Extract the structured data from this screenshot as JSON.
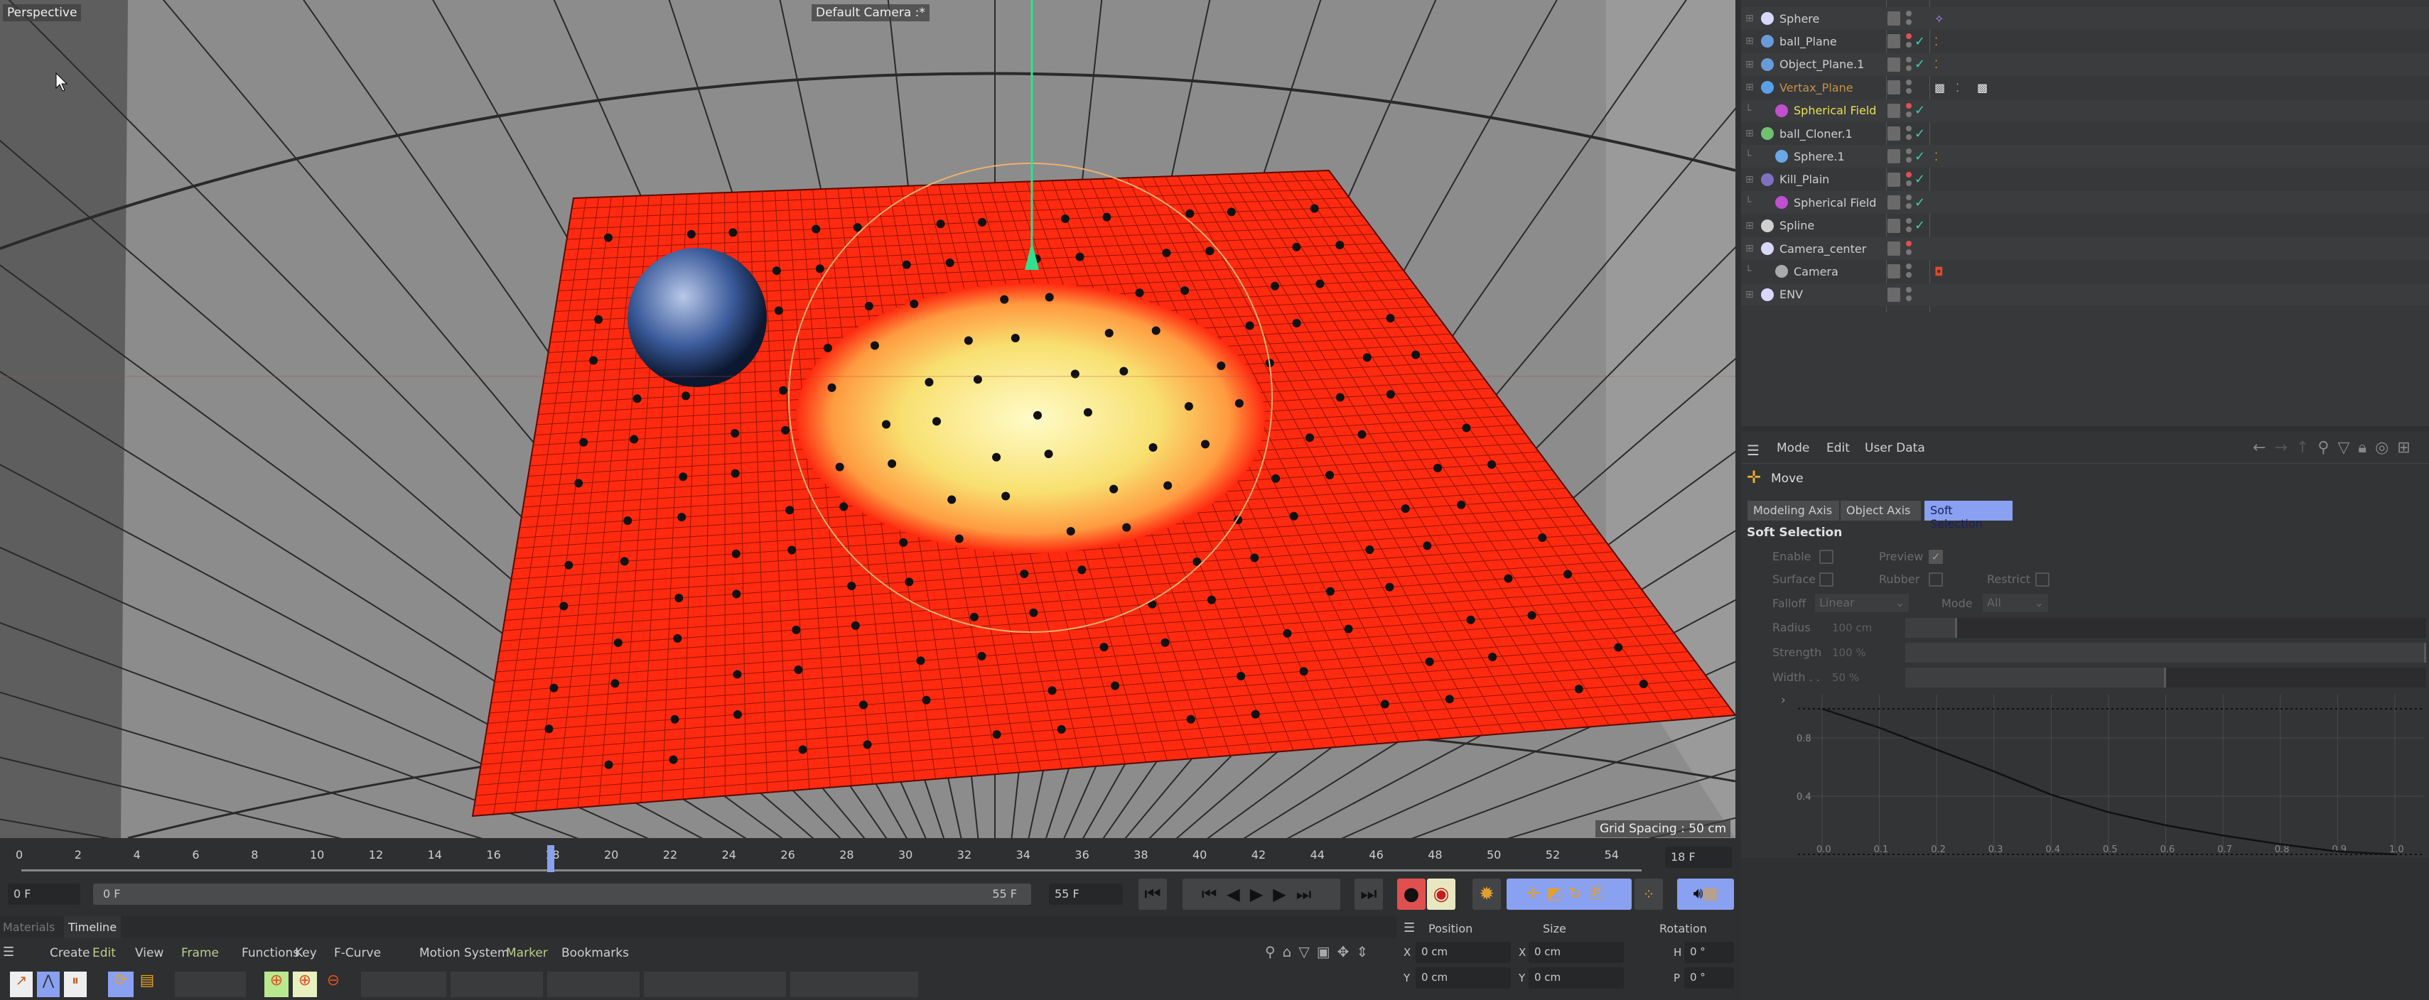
{
  "viewport": {
    "view_name": "Perspective",
    "camera": "Default Camera :*",
    "grid_spacing": "Grid Spacing : 50 cm",
    "colors": {
      "plane": "#ff2a10",
      "falloff_center": "#fff2a0",
      "background": "#8c8c8c"
    }
  },
  "object_manager": {
    "items": [
      {
        "name": "Sphere",
        "icon": "null-icon",
        "level": 0,
        "checked": false,
        "tags": [
          "vibrate-tag-icon"
        ]
      },
      {
        "name": "ball_Plane",
        "icon": "plane-icon",
        "level": 0,
        "checked": true,
        "tags": [
          "material-tag-icon"
        ]
      },
      {
        "name": "Object_Plane.1",
        "icon": "plane-icon",
        "level": 0,
        "checked": true,
        "tags": [
          "material-tag-icon"
        ]
      },
      {
        "name": "Vertax_Plane",
        "icon": "polygon-icon",
        "level": 0,
        "checked": false,
        "tags": [
          "vertex-map-icon",
          "material-tag-icon",
          "checker-tag-icon"
        ],
        "color": "#c8904a"
      },
      {
        "name": "Spherical Field",
        "icon": "spherical-field-icon",
        "level": 1,
        "checked": true,
        "tags": [],
        "color": "#e8e050"
      },
      {
        "name": "ball_Cloner.1",
        "icon": "cloner-icon",
        "level": 0,
        "checked": true,
        "tags": []
      },
      {
        "name": "Sphere.1",
        "icon": "sphere-icon",
        "level": 1,
        "checked": true,
        "tags": [
          "material-tag-icon"
        ]
      },
      {
        "name": "Kill_Plain",
        "icon": "effector-icon",
        "level": 0,
        "checked": true,
        "tags": []
      },
      {
        "name": "Spherical Field",
        "icon": "spherical-field-icon",
        "level": 1,
        "checked": true,
        "tags": []
      },
      {
        "name": "Spline",
        "icon": "spline-icon",
        "level": 0,
        "checked": true,
        "tags": []
      },
      {
        "name": "Camera_center",
        "icon": "null-icon",
        "level": 0,
        "checked": false,
        "tags": []
      },
      {
        "name": "Camera",
        "icon": "camera-icon",
        "level": 1,
        "checked": false,
        "tags": [
          "protection-tag-icon"
        ]
      },
      {
        "name": "ENV",
        "icon": "null-icon",
        "level": 0,
        "checked": false,
        "tags": []
      }
    ]
  },
  "attributes": {
    "menu": [
      "Mode",
      "Edit",
      "User Data"
    ],
    "tool": "Move",
    "tabs": [
      {
        "label": "Modeling Axis",
        "active": false
      },
      {
        "label": "Object Axis",
        "active": false
      },
      {
        "label": "Soft Selection",
        "active": true
      }
    ],
    "section": "Soft Selection",
    "enable": {
      "label": "Enable",
      "checked": false
    },
    "preview": {
      "label": "Preview",
      "checked": true
    },
    "surface": {
      "label": "Surface",
      "checked": false
    },
    "rubber": {
      "label": "Rubber",
      "checked": false
    },
    "restrict": {
      "label": "Restrict",
      "checked": false
    },
    "falloff": {
      "label": "Falloff",
      "value": "Linear"
    },
    "mode": {
      "label": "Mode",
      "value": "All"
    },
    "radius": {
      "label": "Radius",
      "value": "100 cm",
      "fraction": 0.1
    },
    "strength": {
      "label": "Strength",
      "value": "100 %",
      "fraction": 1.0
    },
    "width": {
      "label": "Width . .",
      "value": "50 %",
      "fraction": 0.5
    },
    "curve": {
      "x_ticks": [
        "0.0",
        "0.1",
        "0.2",
        "0.3",
        "0.4",
        "0.5",
        "0.6",
        "0.7",
        "0.8",
        "0.9",
        "1.0"
      ],
      "y_ticks": [
        "0.8",
        "0.4"
      ],
      "points": [
        [
          0,
          1
        ],
        [
          0.1,
          0.87
        ],
        [
          0.2,
          0.72
        ],
        [
          0.3,
          0.57
        ],
        [
          0.4,
          0.41
        ],
        [
          0.5,
          0.29
        ],
        [
          0.6,
          0.2
        ],
        [
          0.7,
          0.13
        ],
        [
          0.8,
          0.07
        ],
        [
          0.9,
          0.02
        ],
        [
          1.0,
          0
        ]
      ]
    }
  },
  "timeline": {
    "ruler": [
      "0",
      "2",
      "4",
      "6",
      "8",
      "10",
      "12",
      "14",
      "16",
      "18",
      "20",
      "22",
      "24",
      "26",
      "28",
      "30",
      "32",
      "34",
      "36",
      "38",
      "40",
      "42",
      "44",
      "46",
      "48",
      "50",
      "52",
      "54"
    ],
    "current_frame": "18 F",
    "current_frame_value": 18,
    "start_field": "0 F",
    "range_start": "0 F",
    "range_end": "55 F",
    "end_field": "55 F",
    "tabs": [
      {
        "label": "Materials",
        "active": false
      },
      {
        "label": "Timeline",
        "active": true
      }
    ],
    "menu": [
      {
        "label": "Create"
      },
      {
        "label": "Edit",
        "hl": true
      },
      {
        "label": "View"
      },
      {
        "label": "Frame",
        "hl": true
      },
      {
        "label": "Functions"
      },
      {
        "label": "Key"
      },
      {
        "label": "F-Curve"
      },
      {
        "label": "Motion System"
      },
      {
        "label": "Marker",
        "hl": true
      },
      {
        "label": "Bookmarks"
      }
    ]
  },
  "coordinates": {
    "headers": [
      "Position",
      "Size",
      "Rotation"
    ],
    "rows": [
      {
        "axis": "X",
        "pos": "0 cm",
        "size_axis": "X",
        "size": "0 cm",
        "rot_axis": "H",
        "rot": "0 °"
      },
      {
        "axis": "Y",
        "pos": "0 cm",
        "size_axis": "Y",
        "size": "0 cm",
        "rot_axis": "P",
        "rot": "0 °"
      }
    ]
  }
}
